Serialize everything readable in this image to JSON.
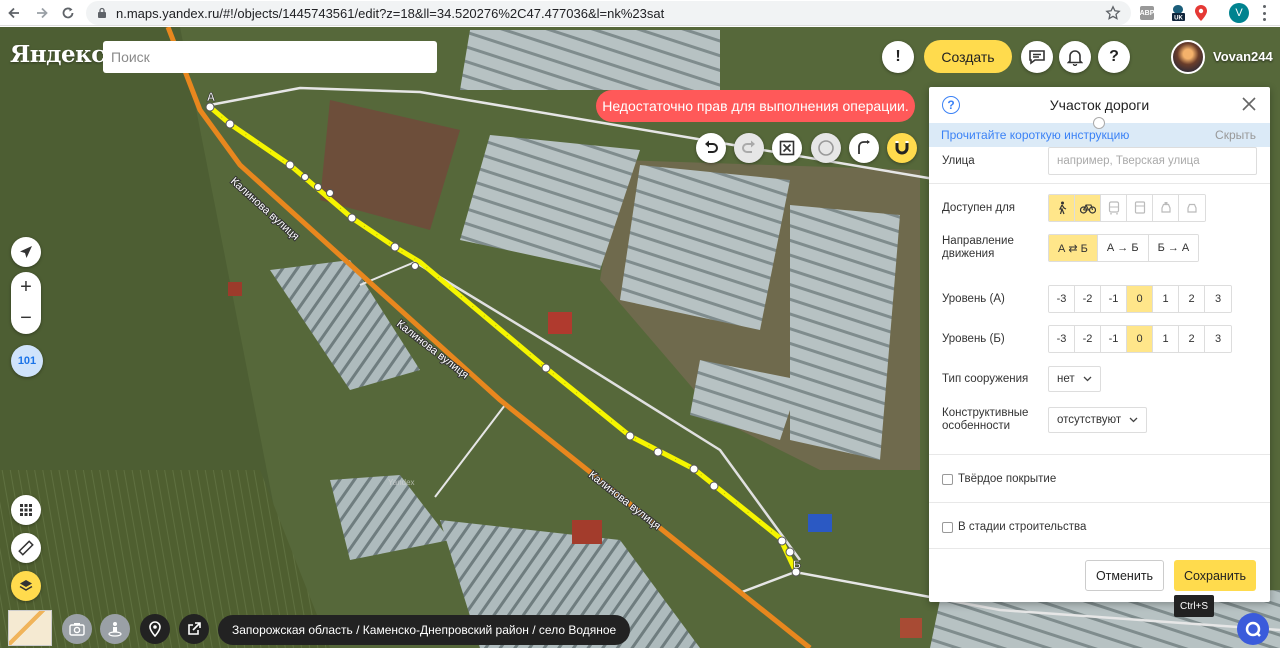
{
  "browser": {
    "url": "n.maps.yandex.ru/#!/objects/1445743561/edit?z=18&ll=34.520276%2C47.477036&l=nk%23sat",
    "ext_abp": "ABP",
    "ext_uk": "UK",
    "profile_initial": "V"
  },
  "header": {
    "logo": "Яндекс",
    "search_placeholder": "Поиск",
    "create_label": "Создать",
    "username": "Vovan244"
  },
  "error_message": "Недостаточно прав для выполнения операции.",
  "map": {
    "point_a_label": "А",
    "point_b_label": "Б",
    "street_label": "Калинова вулиця",
    "badge_value": "101",
    "watermark": "Yandex"
  },
  "breadcrumb": "Запорожская область / Каменско-Днепровский район / село Водяное",
  "panel": {
    "title": "Участок дороги",
    "hint_link": "Прочитайте короткую инструкцию",
    "hint_hide": "Скрыть",
    "street_label": "Улица",
    "street_placeholder": "например, Тверская улица",
    "access_label": "Доступен для",
    "direction_label": "Направление движения",
    "direction_options": [
      "А ⇄ Б",
      "А → Б",
      "Б → А"
    ],
    "direction_selected": 0,
    "level_a_label": "Уровень (А)",
    "level_b_label": "Уровень (Б)",
    "levels": [
      "-3",
      "-2",
      "-1",
      "0",
      "1",
      "2",
      "3"
    ],
    "level_a_selected": 3,
    "level_b_selected": 3,
    "structure_label": "Тип сооружения",
    "structure_value": "нет",
    "features_label": "Конструктивные особенности",
    "features_value": "отсутствуют",
    "hard_surface_label": "Твёрдое покрытие",
    "under_construction_label": "В стадии строительства",
    "cancel_label": "Отменить",
    "save_label": "Сохранить",
    "save_tooltip": "Ctrl+S"
  },
  "colors": {
    "accent_yellow": "#ffdb4d",
    "error_red": "#ff5959",
    "road_orange": "#e8871e",
    "edited_segment": "#f5f500",
    "link_blue": "#3b82f6"
  }
}
